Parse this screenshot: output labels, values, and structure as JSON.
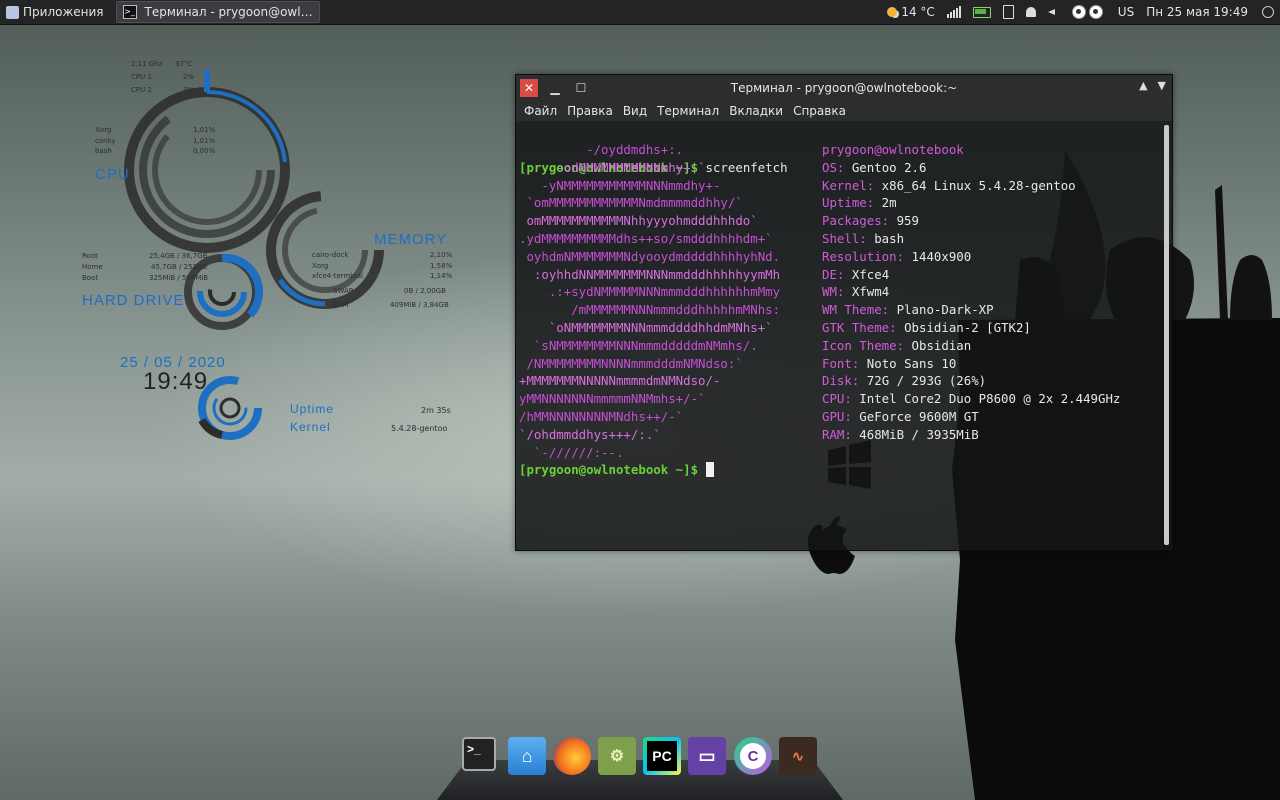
{
  "panel": {
    "apps_label": "Приложения",
    "task_label": "Терминал - prygoon@owl…",
    "weather": "14 °C",
    "layout": "US",
    "datetime": "Пн 25 мая 19:49"
  },
  "conky": {
    "cpu": {
      "freq": "2,11 Ghz",
      "temp": "37°C",
      "cores": [
        {
          "name": "CPU 1",
          "value": "2%"
        },
        {
          "name": "CPU 2",
          "value": "3%"
        }
      ],
      "procs": [
        {
          "name": "Xorg",
          "value": "1,01%"
        },
        {
          "name": "conky",
          "value": "1,01%"
        },
        {
          "name": "bash",
          "value": "0,00%"
        }
      ],
      "title": "CPU"
    },
    "memory": {
      "title": "MEMORY",
      "procs": [
        {
          "name": "cairo-dock",
          "value": "2,10%"
        },
        {
          "name": "Xorg",
          "value": "1,58%"
        },
        {
          "name": "xfce4-terminal",
          "value": "1,14%"
        }
      ],
      "swap_label": "SWAP",
      "swap_value": "0B / 2,00GB",
      "ram_label": "RAM",
      "ram_value": "409MiB / 3,84GB"
    },
    "disk": {
      "title": "HARD DRIVE",
      "rows": [
        {
          "name": "Root",
          "value": "25,4GB / 36,7GB"
        },
        {
          "name": "Home",
          "value": "45,7GB / 253GB"
        },
        {
          "name": "Boot",
          "value": "325MiB / 504MiB"
        }
      ]
    },
    "clock": {
      "date": "25 / 05 / 2020",
      "time": "19:49"
    },
    "system": {
      "uptime_label": "Uptime",
      "uptime_value": "2m 35s",
      "kernel_label": "Kernel",
      "kernel_value": "5.4.28-gentoo"
    }
  },
  "terminal": {
    "title": "Терминал - prygoon@owlnotebook:~",
    "menu": [
      "Файл",
      "Правка",
      "Вид",
      "Терминал",
      "Вкладки",
      "Справка"
    ],
    "prompt": "[prygoon@owlnotebook ~]$",
    "command": "screenfetch",
    "logo_lines": [
      "         -/oyddmdhs+:.",
      "     -odNMMMMMMMMNNmhy+-`",
      "   -yNMMMMMMMMMMMNNNmmdhy+-",
      " `omMMMMMMMMMMMMNmdmmmmddhhy/`",
      " omMMMMMMMMMMMNhhyyyohmdddhhhdo`",
      ".ydMMMMMMMMMMdhs++so/smdddhhhhdm+`",
      " oyhdmNMMMMMMMNdyooydmddddhhhhyhNd.",
      "  :oyhhdNNMMMMMMMNNNmmdddhhhhhyymMh",
      "    .:+sydNMMMMMNNNmmmdddhhhhhhmMmy",
      "       /mMMMMMMNNNmmmdddhhhhhmMNhs:",
      "    `oNMMMMMMMNNNmmmddddhhdmMNhs+`",
      "  `sNMMMMMMMMNNNmmmdddddmNMmhs/.",
      " /NMMMMMMMMNNNNmmmdddmNMNdso:`",
      "+MMMMMMMNNNNNmmmmdmNMNdso/-",
      "yMMNNNNNNNmmmmmNNMmhs+/-`",
      "/hMMNNNNNNNNMNdhs++/-`",
      "`/ohdmmddhys+++/:.`",
      "  `-//////:--."
    ],
    "info": [
      {
        "label": "",
        "value": "prygoon@owlnotebook"
      },
      {
        "label": "OS:",
        "value": "Gentoo 2.6"
      },
      {
        "label": "Kernel:",
        "value": "x86_64 Linux 5.4.28-gentoo"
      },
      {
        "label": "Uptime:",
        "value": "2m"
      },
      {
        "label": "Packages:",
        "value": "959"
      },
      {
        "label": "Shell:",
        "value": "bash"
      },
      {
        "label": "Resolution:",
        "value": "1440x900"
      },
      {
        "label": "DE:",
        "value": "Xfce4"
      },
      {
        "label": "WM:",
        "value": "Xfwm4"
      },
      {
        "label": "WM Theme:",
        "value": "Plano-Dark-XP"
      },
      {
        "label": "GTK Theme:",
        "value": "Obsidian-2 [GTK2]"
      },
      {
        "label": "Icon Theme:",
        "value": "Obsidian"
      },
      {
        "label": "Font:",
        "value": "Noto Sans 10"
      },
      {
        "label": "Disk:",
        "value": "72G / 293G (26%)"
      },
      {
        "label": "CPU:",
        "value": "Intel Core2 Duo P8600 @ 2x 2.449GHz"
      },
      {
        "label": "GPU:",
        "value": "GeForce 9600M GT"
      },
      {
        "label": "RAM:",
        "value": "468MiB / 3935MiB"
      }
    ]
  },
  "dock": {
    "apps": [
      "terminal-app",
      "home-folder-app",
      "firefox-app",
      "android-studio-app",
      "pycharm-app",
      "twitch-app",
      "clion-app",
      "system-monitor-app"
    ],
    "labels": {
      "pycharm": "PC",
      "clion": "C"
    }
  }
}
